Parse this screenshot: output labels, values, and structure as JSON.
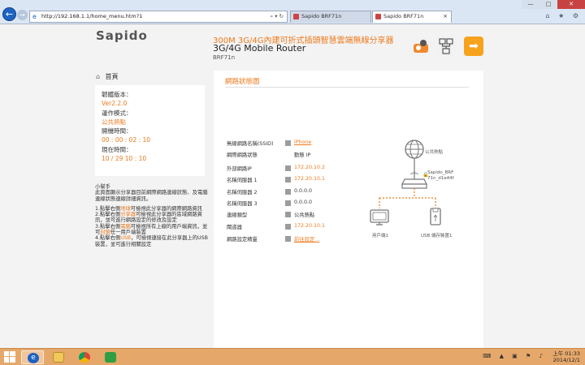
{
  "browser": {
    "url": "http://192.168.1.1/home_menu.htm?1",
    "addr_tools": "⌕ ▾ ↻",
    "tabs": [
      {
        "label": "Sapido BRF71n"
      },
      {
        "label": "Sapido BRF71n"
      }
    ],
    "window_controls": {
      "minimize": "—",
      "maximize": "□",
      "close": "✕"
    },
    "toolbar_icons": "⌂ ★ ⚙"
  },
  "header": {
    "logo": "Sapido",
    "title_cn": "300M 3G/4G內建可折式插頭智慧雲端無線分享器",
    "title_en": "3G/4G Mobile Router",
    "model": "BRF71n",
    "logout_arrow": "➡"
  },
  "sidebar": {
    "home_label": "首頁",
    "info": [
      {
        "label": "韌體版本：",
        "value": "Ver2.2.0"
      },
      {
        "label": "運作模式：",
        "value": "公共熱點"
      },
      {
        "label": "開機時間：",
        "value": "00 : 00 : 02 : 10"
      },
      {
        "label": "現在時間：",
        "value": "10 / 29  10 : 10"
      }
    ],
    "help_title": "小幫手",
    "help_text": "此頁面顯示分享器目前網際網路連線狀態、及電腦連線狀態連線詳細資訊。",
    "help_items": [
      {
        "pre": "1.點擊右側",
        "hl": "地球",
        "post": "可檢視此分享器的網際網路資訊"
      },
      {
        "pre": "2.點擊右側",
        "hl": "分享器",
        "post": "可檢視此分享器的區域網路資訊，並可進行網路設定的修改及設定"
      },
      {
        "pre": "3.點擊右側",
        "hl": "電腦",
        "post": "可檢視所有上線的用戶端資訊，並可",
        "hl2": "封鎖",
        "post2": "任一用戶端裝置"
      },
      {
        "pre": "4.點擊右側",
        "hl": "USB",
        "post": "，可檢視連接在此分享器上的USB裝置，並可進行相關設定"
      }
    ]
  },
  "panel": {
    "title": "網路狀態圖",
    "rows": [
      {
        "label": "無線網路名稱(SSID)",
        "value": "iPhone",
        "style": "link"
      },
      {
        "label": "網際網路狀態",
        "value": "動態 IP",
        "style": "plain"
      },
      {
        "label": "外部網路IP",
        "value": "172.20.10.2",
        "style": "or"
      },
      {
        "label": "名稱伺服器 1",
        "value": "172.20.10.1",
        "style": "or"
      },
      {
        "label": "名稱伺服器 2",
        "value": "0.0.0.0",
        "style": "plain"
      },
      {
        "label": "名稱伺服器 3",
        "value": "0.0.0.0",
        "style": "plain"
      },
      {
        "label": "連線類型",
        "value": "公共熱點",
        "style": "plain"
      },
      {
        "label": "閘道器",
        "value": "172.20.10.1",
        "style": "or"
      },
      {
        "label": "網路設定精靈",
        "value": "前往設定...",
        "style": "link"
      }
    ],
    "diagram": {
      "internet_label": "公共熱點",
      "router_label_1": "Sapido_BRF",
      "router_label_2": "71n_d1e44f",
      "pc_label": "用戶端1",
      "usb_label": "USB 儲存裝置1"
    }
  },
  "taskbar": {
    "time": "上午 01:33",
    "date": "2014/12/1",
    "tray_icons": "⌨ ▲ ▣ ⚑ ♪"
  },
  "colors": {
    "accent": "#ee7a1c",
    "taskbar": "#e6a86a",
    "ie_blue": "#1e63c4"
  }
}
